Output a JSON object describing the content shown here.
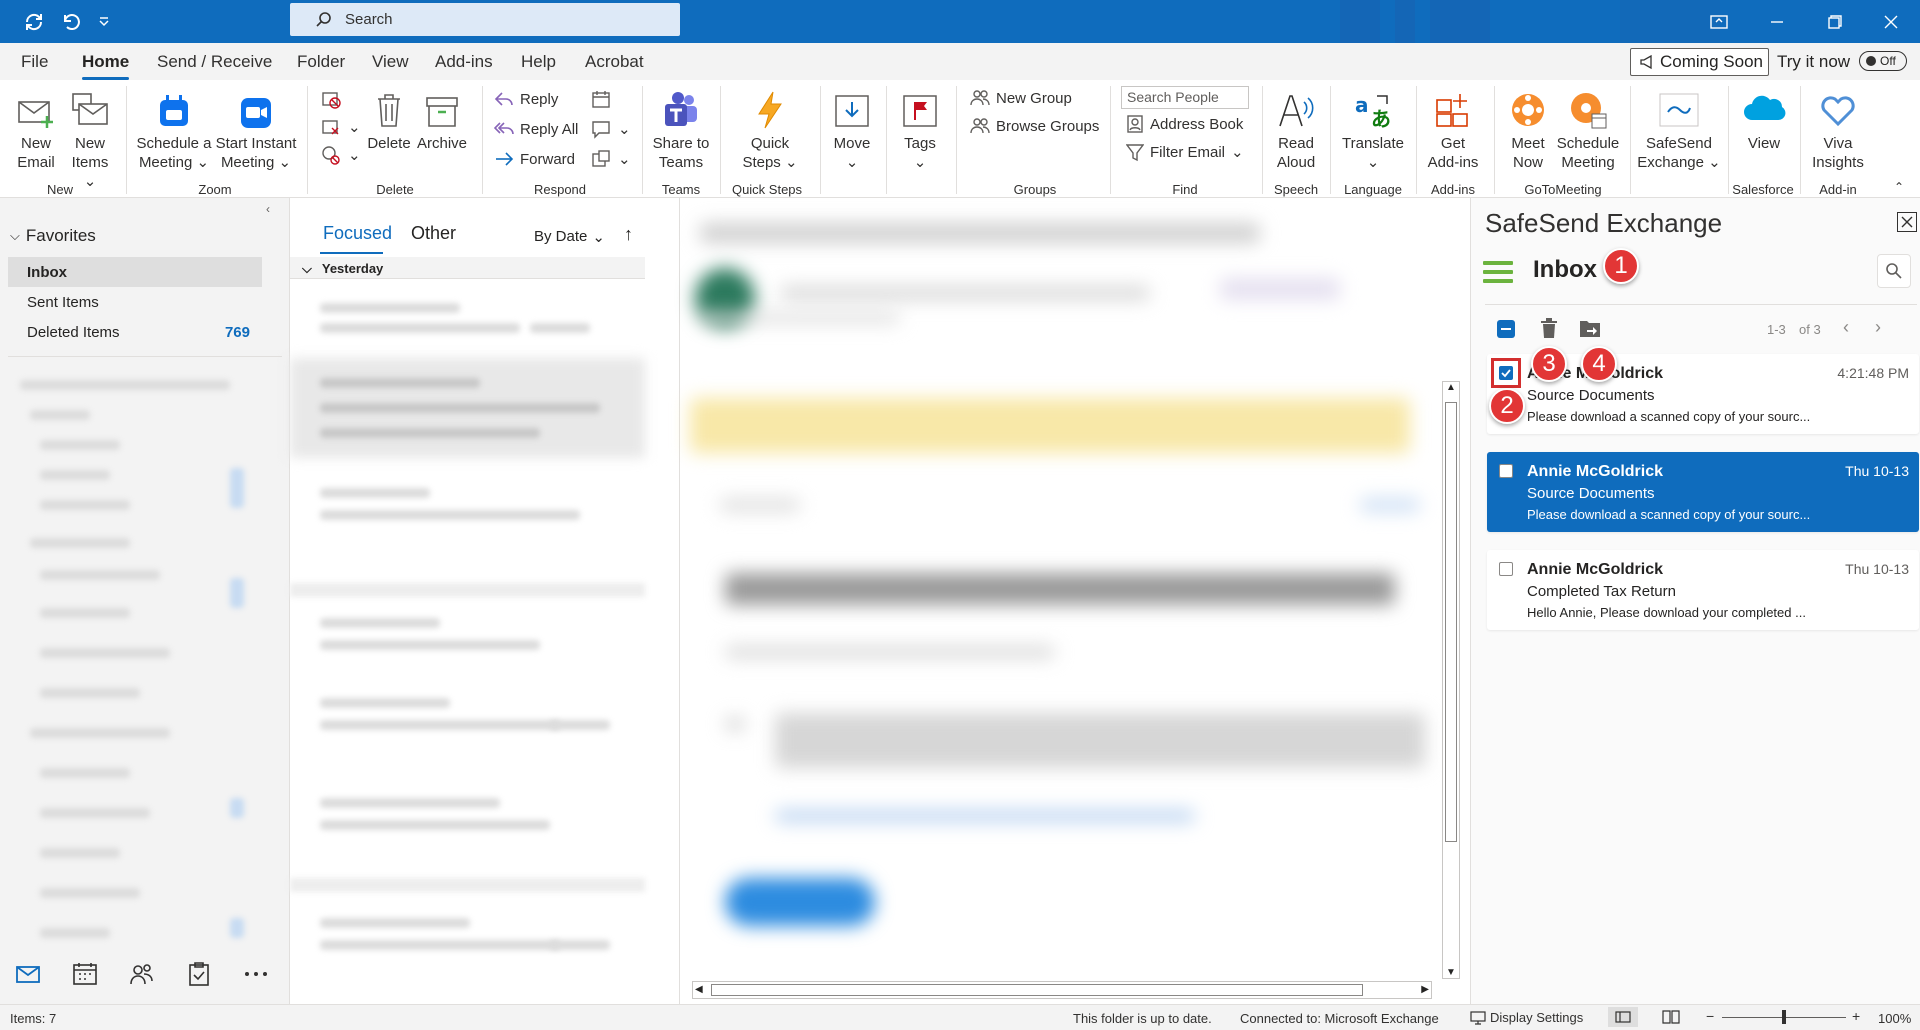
{
  "titlebar": {
    "search_placeholder": "Search"
  },
  "menu": {
    "tabs": [
      "File",
      "Home",
      "Send / Receive",
      "Folder",
      "View",
      "Add-ins",
      "Help",
      "Acrobat"
    ],
    "coming_soon": "Coming Soon",
    "try_it_now": "Try it now",
    "toggle": "Off"
  },
  "ribbon": {
    "new_email": [
      "New",
      "Email"
    ],
    "new_items": [
      "New",
      "Items"
    ],
    "schedule_meeting": [
      "Schedule a",
      "Meeting"
    ],
    "start_instant": [
      "Start Instant",
      "Meeting"
    ],
    "delete": "Delete",
    "archive": "Archive",
    "reply": "Reply",
    "reply_all": "Reply All",
    "forward": "Forward",
    "share_teams": [
      "Share to",
      "Teams"
    ],
    "quick_steps": [
      "Quick",
      "Steps"
    ],
    "move": "Move",
    "tags": "Tags",
    "new_group": "New Group",
    "browse_groups": "Browse Groups",
    "search_people": "Search People",
    "address_book": "Address Book",
    "filter_email": "Filter Email",
    "read_aloud": [
      "Read",
      "Aloud"
    ],
    "translate": "Translate",
    "get_addins": [
      "Get",
      "Add-ins"
    ],
    "meet_now": [
      "Meet",
      "Now"
    ],
    "schedule_gtm": [
      "Schedule",
      "Meeting"
    ],
    "safesend": [
      "SafeSend",
      "Exchange"
    ],
    "view": "View",
    "viva": [
      "Viva",
      "Insights"
    ],
    "groups": [
      "New",
      "Zoom",
      "Delete",
      "Respond",
      "Teams",
      "Quick Steps",
      "Groups",
      "Find",
      "Speech",
      "Language",
      "Add-ins",
      "GoToMeeting",
      "Salesforce",
      "Add-in"
    ]
  },
  "nav": {
    "favorites": "Favorites",
    "inbox": "Inbox",
    "sent": "Sent Items",
    "deleted": "Deleted Items",
    "deleted_count": "769"
  },
  "msglist": {
    "focused": "Focused",
    "other": "Other",
    "sort": "By Date",
    "group": "Yesterday"
  },
  "safesend": {
    "title": "SafeSend Exchange",
    "inbox": "Inbox",
    "page": "1-3",
    "of": "of 3",
    "emails": [
      {
        "from": "Annie McGoldrick",
        "subject": "Source Documents",
        "preview": "Please download a scanned copy of your sourc...",
        "time": "4:21:48 PM"
      },
      {
        "from": "Annie McGoldrick",
        "subject": "Source Documents",
        "preview": "Please download a scanned copy of your sourc...",
        "time": "Thu 10-13"
      },
      {
        "from": "Annie McGoldrick",
        "subject": "Completed Tax Return",
        "preview": "Hello Annie,  Please download your completed ...",
        "time": "Thu 10-13"
      }
    ],
    "badges": [
      "1",
      "2",
      "3",
      "4"
    ]
  },
  "status": {
    "items": "Items: 7",
    "uptodate": "This folder is up to date.",
    "connected": "Connected to: Microsoft Exchange",
    "display": "Display Settings",
    "zoom": "100%"
  },
  "colors": {
    "accent": "#0f6cbd",
    "badge": "#e23636",
    "ribbon_green": "#6bb33e"
  }
}
